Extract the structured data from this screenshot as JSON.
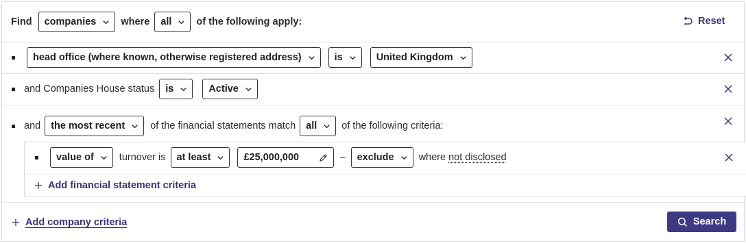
{
  "header": {
    "find_label": "Find",
    "entity_select": "companies",
    "where_label": "where",
    "match_select": "all",
    "following_label": "of the following apply:",
    "reset_label": "Reset"
  },
  "criteria": {
    "location": {
      "field_select": "head office (where known, otherwise registered address)",
      "operator_select": "is",
      "value_select": "United Kingdom"
    },
    "status": {
      "label": "and Companies House status",
      "operator_select": "is",
      "value_select": "Active"
    },
    "financial": {
      "and_label": "and",
      "recency_select": "the most recent",
      "statements_label": "of the financial statements match",
      "match_select": "all",
      "following_label": "of the following criteria:",
      "sub": {
        "field_select": "value of",
        "turnover_label": "turnover is",
        "comparator_select": "at least",
        "amount_value": "£25,000,000",
        "dash": "–",
        "disclosure_select": "exclude",
        "where_label": "where",
        "not_disclosed_label": "not disclosed"
      },
      "add_fs_label": "Add financial statement criteria"
    }
  },
  "footer": {
    "add_company_label": "Add company criteria",
    "search_label": "Search"
  },
  "colors": {
    "accent": "#3d3a84",
    "link": "#35357a",
    "border": "#d9d9de"
  },
  "icons": {
    "reset": "return-arrow-icon",
    "remove": "close-icon",
    "dropdown": "chevron-down-icon",
    "edit": "pencil-icon",
    "add": "plus-icon",
    "search": "search-icon"
  }
}
